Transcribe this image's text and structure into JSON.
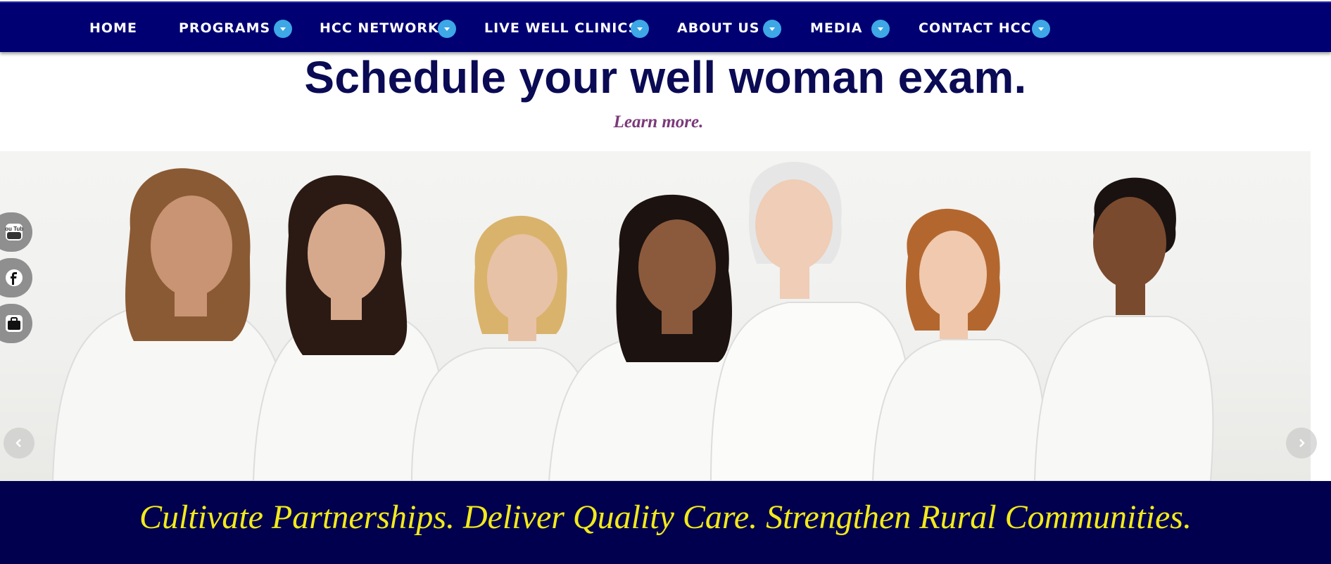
{
  "nav": {
    "items": [
      {
        "label": "HOME",
        "has_dropdown": false
      },
      {
        "label": "PROGRAMS",
        "has_dropdown": true
      },
      {
        "label": "HCC NETWORK",
        "has_dropdown": true
      },
      {
        "label": "LIVE WELL CLINICS",
        "has_dropdown": true
      },
      {
        "label": "ABOUT US",
        "has_dropdown": true
      },
      {
        "label": "MEDIA",
        "has_dropdown": true
      },
      {
        "label": "CONTACT HCC",
        "has_dropdown": true
      }
    ],
    "dropdown_icon": "chevron-down-icon"
  },
  "hero": {
    "headline": "Schedule your well woman exam.",
    "link": "Learn more.",
    "image_description_icon": "hero-photo",
    "prev_icon": "chevron-left-icon",
    "next_icon": "chevron-right-icon"
  },
  "social": [
    {
      "icon": "youtube-icon",
      "label": "You Tube"
    },
    {
      "icon": "facebook-icon",
      "label": "f"
    },
    {
      "icon": "briefcase-icon",
      "label": ""
    }
  ],
  "tagline": "Cultivate Partnerships. Deliver Quality Care. Strengthen Rural Communities.",
  "colors": {
    "nav_bg": "#000073",
    "caret": "#3ea7e6",
    "headline": "#0a0a55",
    "link": "#7b3a7a",
    "banner_bg": "#00004f",
    "tagline": "#f2ea1a"
  }
}
